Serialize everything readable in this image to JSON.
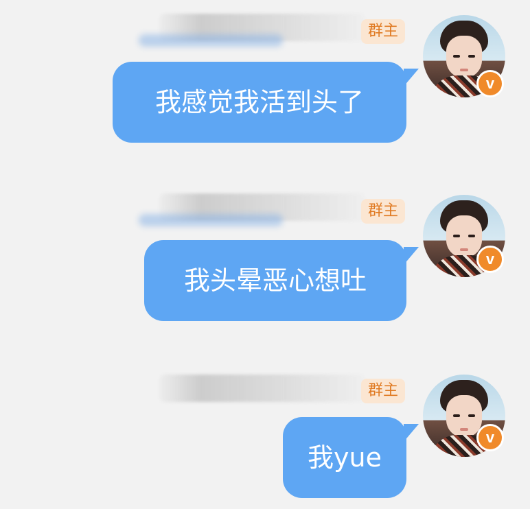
{
  "messages": [
    {
      "badge": "群主",
      "text": "我感觉我活到头了"
    },
    {
      "badge": "群主",
      "text": "我头晕恶心想吐"
    },
    {
      "badge": "群主",
      "text": "我yue"
    }
  ],
  "verified_badge_glyph": "v",
  "colors": {
    "bubble": "#5ea6f3",
    "badge_bg": "#fbe6d2",
    "badge_text": "#e07a22",
    "vbadge": "#f08a2a",
    "background": "#f2f2f2"
  },
  "icons": {
    "avatar": "avatar-photo",
    "verified": "verified-v-icon"
  }
}
